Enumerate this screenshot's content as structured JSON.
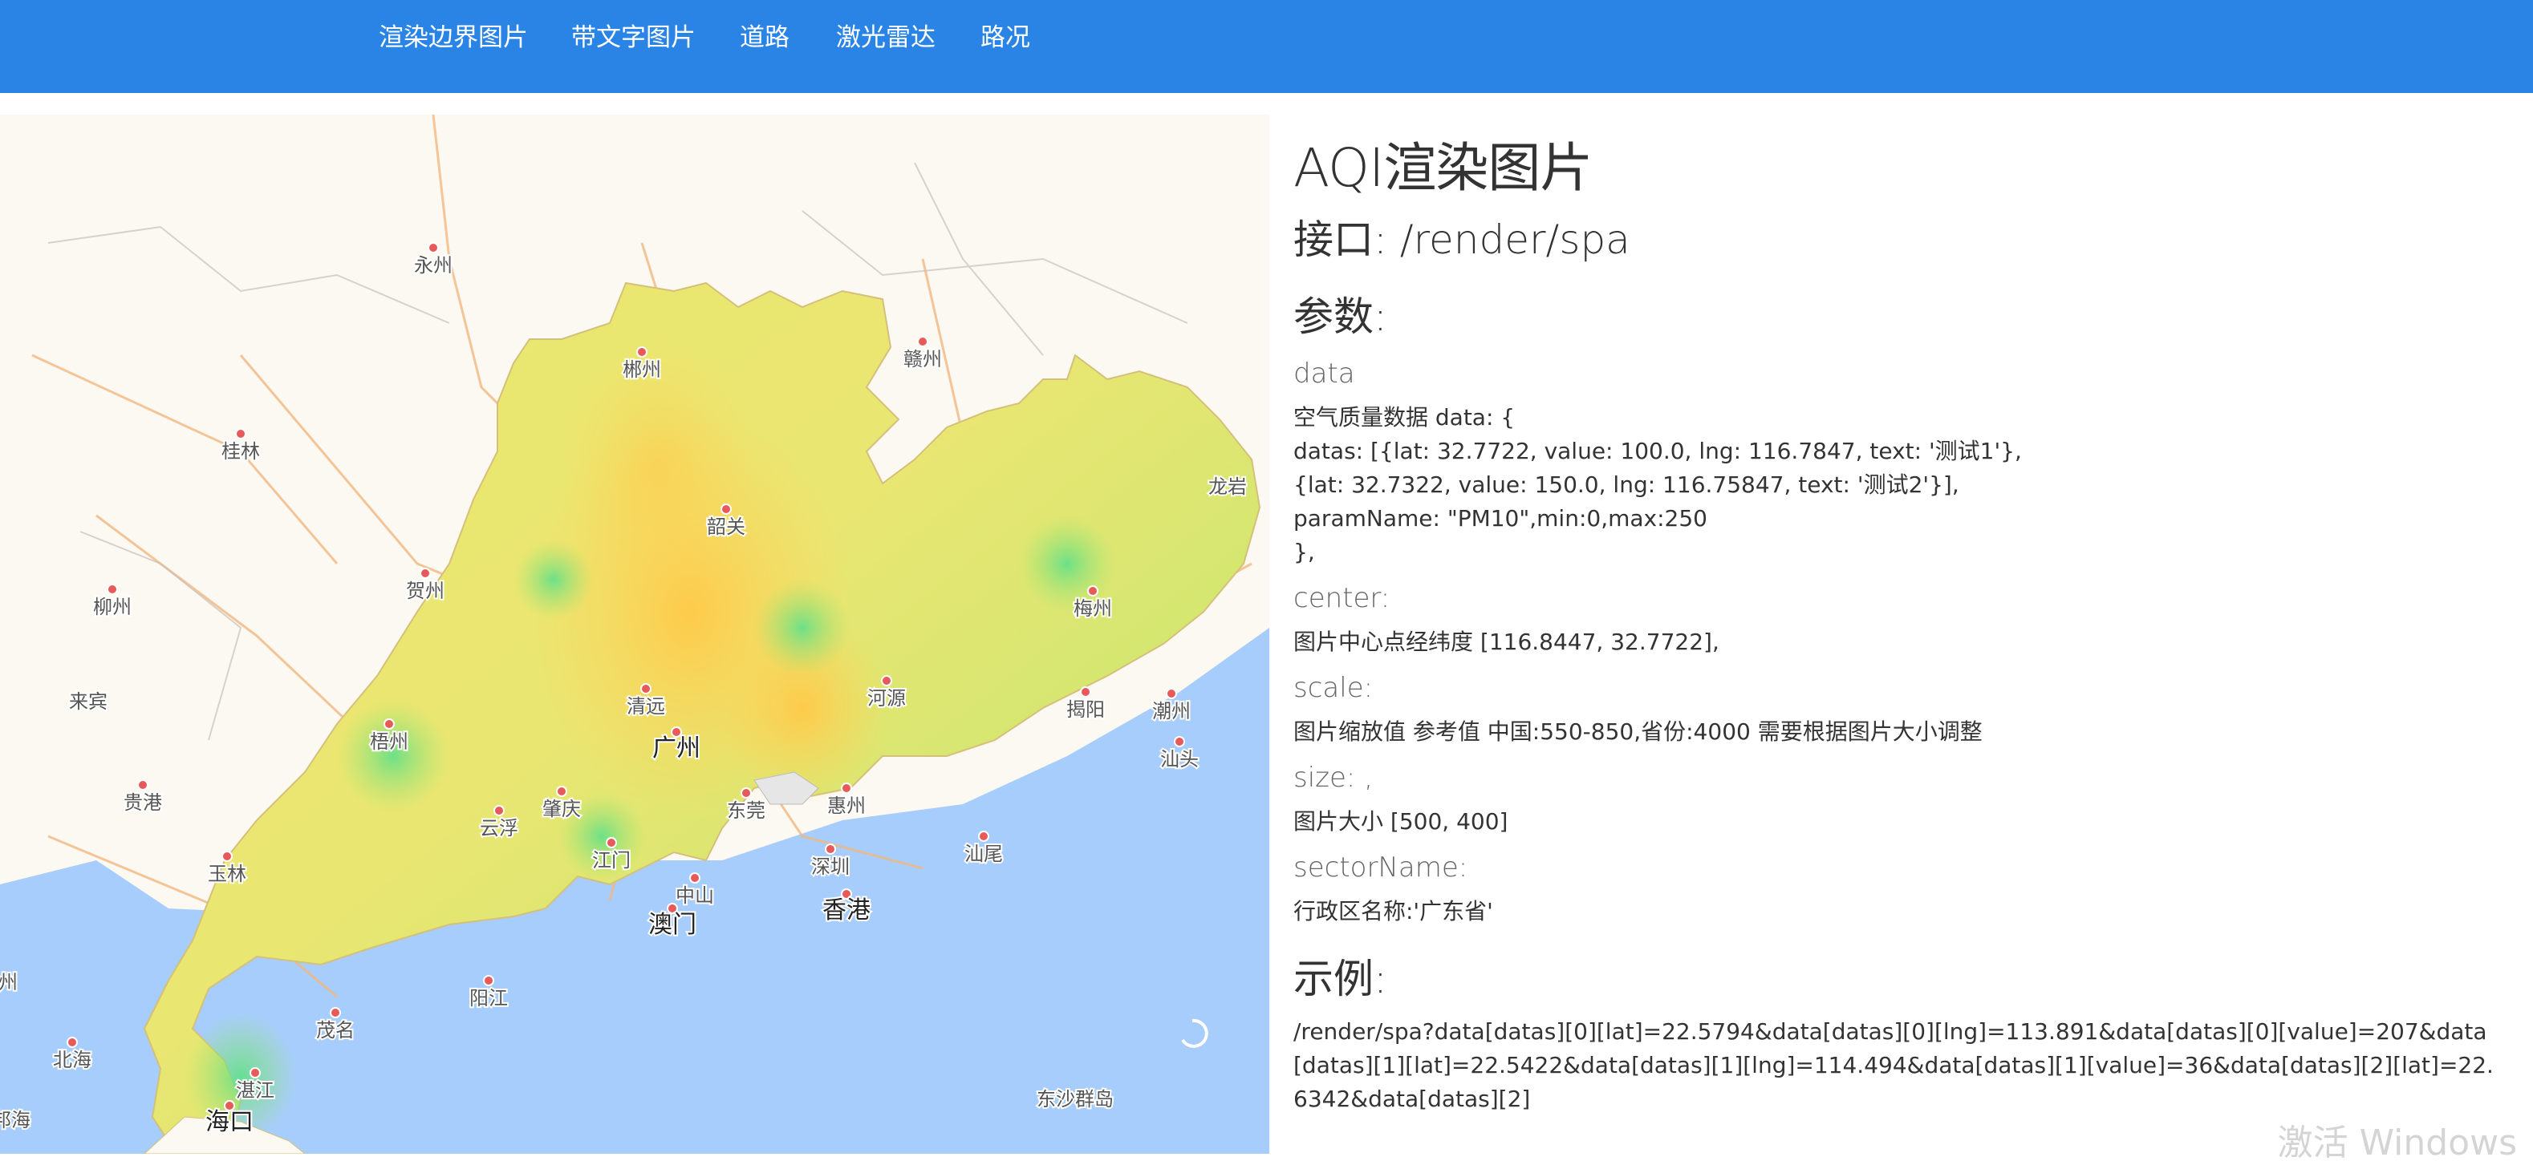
{
  "nav": {
    "items": [
      {
        "label": "渲染边界图片"
      },
      {
        "label": "带文字图片"
      },
      {
        "label": "道路"
      },
      {
        "label": "激光雷达"
      },
      {
        "label": "路况"
      }
    ]
  },
  "map": {
    "colors": {
      "land": "#fcf9f2",
      "sea": "#a6cdfb",
      "province_low": "#9fe36e",
      "province_mid": "#e6ea72",
      "province_high": "#ffd45a",
      "road": "#f2b780",
      "border": "#b9a9a3"
    },
    "cities": [
      {
        "name": "永州"
      },
      {
        "name": "郴州"
      },
      {
        "name": "赣州"
      },
      {
        "name": "桂林"
      },
      {
        "name": "韶关"
      },
      {
        "name": "龙岩"
      },
      {
        "name": "贺州"
      },
      {
        "name": "柳州"
      },
      {
        "name": "梅州"
      },
      {
        "name": "来宾"
      },
      {
        "name": "清远"
      },
      {
        "name": "河源"
      },
      {
        "name": "揭阳"
      },
      {
        "name": "潮州"
      },
      {
        "name": "梧州"
      },
      {
        "name": "汕头"
      },
      {
        "name": "广州"
      },
      {
        "name": "贵港"
      },
      {
        "name": "肇庆"
      },
      {
        "name": "东莞"
      },
      {
        "name": "惠州"
      },
      {
        "name": "云浮"
      },
      {
        "name": "江门"
      },
      {
        "name": "深圳"
      },
      {
        "name": "汕尾"
      },
      {
        "name": "玉林"
      },
      {
        "name": "中山"
      },
      {
        "name": "香港"
      },
      {
        "name": "澳门"
      },
      {
        "name": "阳江"
      },
      {
        "name": "茂名"
      },
      {
        "name": "北海"
      },
      {
        "name": "湛江"
      },
      {
        "name": "东沙群岛"
      },
      {
        "name": "海口"
      },
      {
        "name": "州"
      },
      {
        "name": "邦海"
      }
    ]
  },
  "doc": {
    "title": "AQI渲染图片",
    "api": "接口:  /render/spa",
    "params_heading": "参数:",
    "params": [
      {
        "name": "data",
        "desc": "空气质量数据 data: {\ndatas: [{lat: 32.7722, value: 100.0, lng: 116.7847, text: '测试1'},\n{lat: 32.7322, value: 150.0, lng: 116.75847, text: '测试2'}],\nparamName: \"PM10\",min:0,max:250\n},"
      },
      {
        "name": "center:",
        "desc": "图片中心点经纬度 [116.8447, 32.7722],"
      },
      {
        "name": "scale:",
        "desc": "图片缩放值 参考值 中国:550-850,省份:4000 需要根据图片大小调整"
      },
      {
        "name": "size: ,",
        "desc": "图片大小 [500, 400]"
      },
      {
        "name": "sectorName:",
        "desc": "行政区名称:'广东省'"
      }
    ],
    "example_heading": "示例:",
    "example": "/render/spa?data[datas][0][lat]=22.5794&data[datas][0][lng]=113.891&data[datas][0][value]=207&data[datas][1][lat]=22.5422&data[datas][1][lng]=114.494&data[datas][1][value]=36&data[datas][2][lat]=22.6342&data[datas][2]"
  },
  "watermark": "激活 Windows"
}
